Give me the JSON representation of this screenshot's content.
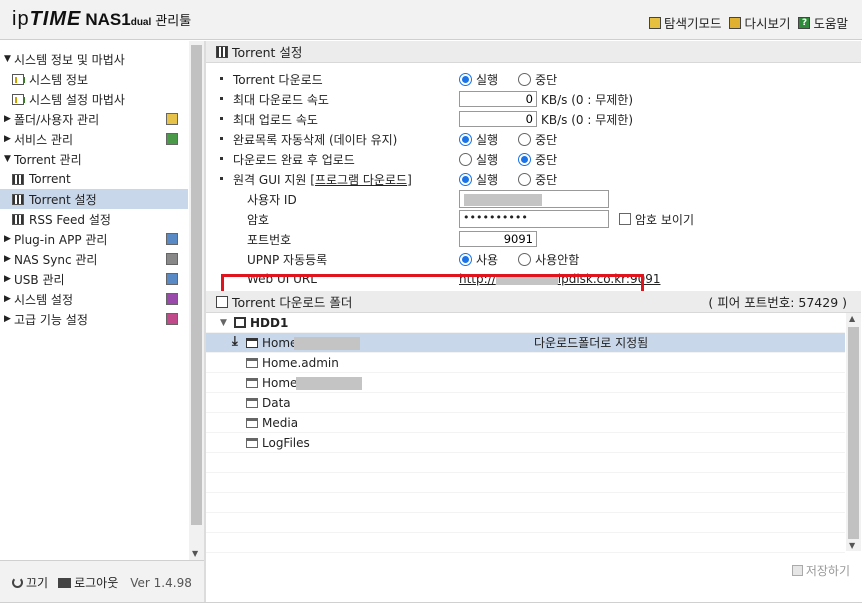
{
  "header": {
    "logo_ip": "ip",
    "logo_time": "TIME",
    "logo_nas": "NAS1",
    "logo_dual": "dual",
    "logo_tool": "관리툴",
    "links": [
      {
        "label": "탐색기모드",
        "icon": "explorer-icon"
      },
      {
        "label": "다시보기",
        "icon": "refresh-icon"
      },
      {
        "label": "도움말",
        "icon": "help-icon"
      }
    ]
  },
  "sidebar": {
    "items": [
      {
        "label": "시스템 정보 및 마법사",
        "expanded": true
      },
      {
        "label": "시스템 정보"
      },
      {
        "label": "시스템 설정 마법사"
      },
      {
        "label": "폴더/사용자 관리",
        "expanded": false
      },
      {
        "label": "서비스 관리",
        "expanded": false
      },
      {
        "label": "Torrent 관리",
        "expanded": true
      },
      {
        "label": "Torrent"
      },
      {
        "label": "Torrent 설정",
        "active": true
      },
      {
        "label": "RSS Feed 설정"
      },
      {
        "label": "Plug-in APP 관리",
        "expanded": false
      },
      {
        "label": "NAS Sync 관리",
        "expanded": false
      },
      {
        "label": "USB 관리",
        "expanded": false
      },
      {
        "label": "시스템 설정",
        "expanded": false
      },
      {
        "label": "고급 기능 설정",
        "expanded": false
      }
    ],
    "footer": {
      "power_label": "끄기",
      "logout_label": "로그아웃",
      "version": "Ver 1.4.98"
    }
  },
  "settings": {
    "title": "Torrent 설정",
    "torrent_download": {
      "label": "Torrent 다운로드",
      "opt1": "실행",
      "opt2": "중단",
      "selected": "실행"
    },
    "max_down": {
      "label": "최대 다운로드 속도",
      "value": "0",
      "unit": "KB/s (0 : 무제한)"
    },
    "max_up": {
      "label": "최대 업로드 속도",
      "value": "0",
      "unit": "KB/s (0 : 무제한)"
    },
    "auto_delete": {
      "label": "완료목록 자동삭제 (데이타 유지)",
      "opt1": "실행",
      "opt2": "중단",
      "selected": "실행"
    },
    "upload_after": {
      "label": "다운로드 완료 후 업로드",
      "opt1": "실행",
      "opt2": "중단",
      "selected": "중단"
    },
    "remote_gui": {
      "label_prefix": "원격 GUI 지원 [",
      "label_link": "프로그램 다운로드",
      "label_suffix": "]",
      "opt1": "실행",
      "opt2": "중단",
      "selected": "실행"
    },
    "user_id": {
      "label": "사용자 ID"
    },
    "password": {
      "label": "암호",
      "value": "••••••••••",
      "show_label": "암호 보이기"
    },
    "port": {
      "label": "포트번호",
      "value": "9091"
    },
    "upnp": {
      "label": "UPNP 자동등록",
      "opt1": "사용",
      "opt2": "사용안함",
      "selected": "사용"
    },
    "webui": {
      "label": "Web UI URL",
      "url_prefix": "http://",
      "url_suffix": "ipdisk.co.kr:9091"
    }
  },
  "folder_section": {
    "title": "Torrent 다운로드 폴더",
    "peer_port": "( 피어 포트번호: 57429 )",
    "hdd": "HDD1",
    "folders": [
      {
        "name": "Home",
        "note": "다운로드폴더로 지정됨",
        "selected": true
      },
      {
        "name": "Home.admin",
        "note": ""
      },
      {
        "name": "Home",
        "note": ""
      },
      {
        "name": "Data",
        "note": ""
      },
      {
        "name": "Media",
        "note": ""
      },
      {
        "name": "LogFiles",
        "note": ""
      }
    ]
  },
  "save_label": "저장하기",
  "colors": {
    "highlight": "#e0141c",
    "selected_row": "#c9d7ea",
    "radio_on": "#1a73e8"
  }
}
